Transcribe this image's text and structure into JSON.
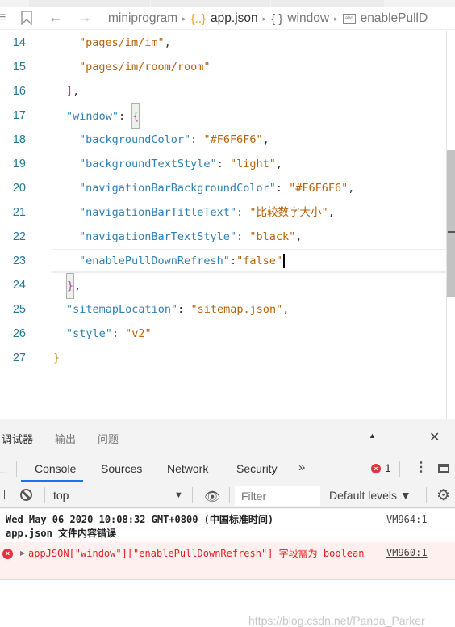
{
  "breadcrumb": {
    "items": [
      {
        "label": "miniprogram",
        "icon": "none"
      },
      {
        "label": "app.json",
        "icon": "json-icon"
      },
      {
        "label": "window",
        "icon": "object-icon"
      },
      {
        "label": "enablePullD",
        "icon": "string-property-icon"
      }
    ],
    "icons": {
      "menu": "≡",
      "json": "{..}",
      "object": "{ }",
      "abc": "abc",
      "separator": "▸",
      "back": "←",
      "forward": "→"
    }
  },
  "editor": {
    "lines": [
      {
        "num": "14",
        "tokens": [
          {
            "t": "s",
            "v": "\"pages/im/im\""
          },
          {
            "t": "p",
            "v": ","
          }
        ]
      },
      {
        "num": "15",
        "tokens": [
          {
            "t": "s",
            "v": "\"pages/im/room/room\""
          }
        ]
      },
      {
        "num": "16",
        "tokens": [
          {
            "t": "b",
            "v": "]"
          },
          {
            "t": "p",
            "v": ","
          }
        ]
      },
      {
        "num": "17",
        "tokens": [
          {
            "t": "k",
            "v": "\"window\""
          },
          {
            "t": "p",
            "v": ": "
          },
          {
            "t": "b",
            "v": "{"
          }
        ]
      },
      {
        "num": "18",
        "tokens": [
          {
            "t": "k",
            "v": "\"backgroundColor\""
          },
          {
            "t": "p",
            "v": ": "
          },
          {
            "t": "s",
            "v": "\"#F6F6F6\""
          },
          {
            "t": "p",
            "v": ","
          }
        ]
      },
      {
        "num": "19",
        "tokens": [
          {
            "t": "k",
            "v": "\"backgroundTextStyle\""
          },
          {
            "t": "p",
            "v": ": "
          },
          {
            "t": "s",
            "v": "\"light\""
          },
          {
            "t": "p",
            "v": ","
          }
        ]
      },
      {
        "num": "20",
        "tokens": [
          {
            "t": "k",
            "v": "\"navigationBarBackgroundColor\""
          },
          {
            "t": "p",
            "v": ": "
          },
          {
            "t": "s",
            "v": "\"#F6F6F6\""
          },
          {
            "t": "p",
            "v": ","
          }
        ]
      },
      {
        "num": "21",
        "tokens": [
          {
            "t": "k",
            "v": "\"navigationBarTitleText\""
          },
          {
            "t": "p",
            "v": ": "
          },
          {
            "t": "s",
            "v": "\"比较数字大小\""
          },
          {
            "t": "p",
            "v": ","
          }
        ]
      },
      {
        "num": "22",
        "tokens": [
          {
            "t": "k",
            "v": "\"navigationBarTextStyle\""
          },
          {
            "t": "p",
            "v": ": "
          },
          {
            "t": "s",
            "v": "\"black\""
          },
          {
            "t": "p",
            "v": ","
          }
        ]
      },
      {
        "num": "23",
        "tokens": [
          {
            "t": "k",
            "v": "\"enablePullDownRefresh\""
          },
          {
            "t": "p",
            "v": ":"
          },
          {
            "t": "s",
            "v": "\"false\""
          }
        ]
      },
      {
        "num": "24",
        "tokens": [
          {
            "t": "b",
            "v": "}"
          },
          {
            "t": "p",
            "v": ","
          }
        ]
      },
      {
        "num": "25",
        "tokens": [
          {
            "t": "k",
            "v": "\"sitemapLocation\""
          },
          {
            "t": "p",
            "v": ": "
          },
          {
            "t": "s",
            "v": "\"sitemap.json\""
          },
          {
            "t": "p",
            "v": ","
          }
        ]
      },
      {
        "num": "26",
        "tokens": [
          {
            "t": "k",
            "v": "\"style\""
          },
          {
            "t": "p",
            "v": ": "
          },
          {
            "t": "s",
            "v": "\"v2\""
          }
        ]
      },
      {
        "num": "27",
        "tokens": [
          {
            "t": "br",
            "v": "}"
          }
        ]
      }
    ],
    "current_line": "23"
  },
  "devtools": {
    "tabs": [
      "调试器",
      "输出",
      "问题"
    ],
    "active_tab": "调试器",
    "panel_tabs": [
      "Console",
      "Sources",
      "Network",
      "Security"
    ],
    "active_panel": "Console",
    "more_icon": "»",
    "error_count": "1",
    "context": "top",
    "filter_placeholder": "Filter",
    "levels": "Default levels ▼"
  },
  "console": {
    "messages": [
      {
        "type": "log",
        "text": "Wed May 06 2020 10:08:32 GMT+0800 (中国标准时间)\napp.json 文件内容错误",
        "source": "VM964:1"
      },
      {
        "type": "error",
        "text": "appJSON[\"window\"][\"enablePullDownRefresh\"] 字段需为 boolean",
        "source": "VM960:1"
      }
    ]
  },
  "watermark": "https://blog.csdn.net/Panda_Parker",
  "colors": {
    "key": "#2f7fb3",
    "string": "#b5620b",
    "bracket": "#b03fa8",
    "line_number": "#237893",
    "accent": "#1a73e8",
    "error": "#e5323c"
  }
}
